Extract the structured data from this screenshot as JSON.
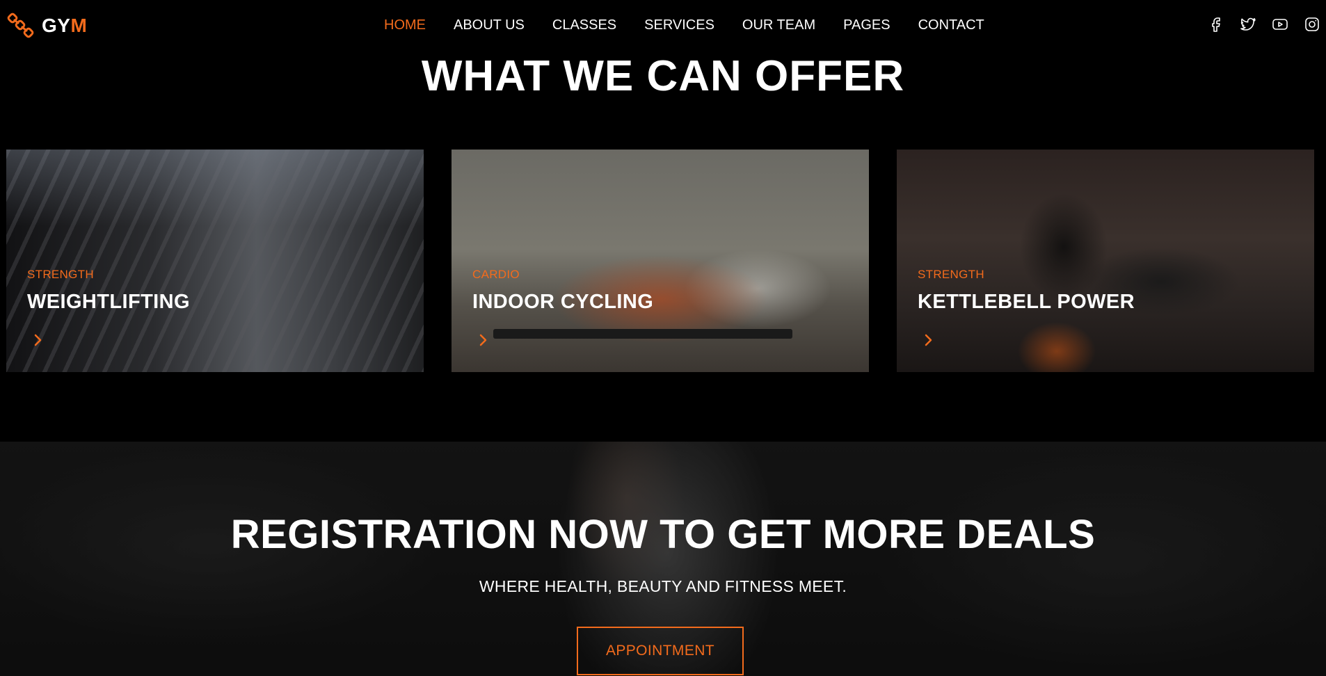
{
  "brand": {
    "logo_main": "GY",
    "logo_accent": "M"
  },
  "nav": {
    "items": [
      {
        "label": "HOME",
        "active": true
      },
      {
        "label": "ABOUT US"
      },
      {
        "label": "CLASSES"
      },
      {
        "label": "SERVICES"
      },
      {
        "label": "OUR TEAM"
      },
      {
        "label": "PAGES"
      },
      {
        "label": "CONTACT"
      }
    ]
  },
  "social": [
    "facebook-icon",
    "twitter-icon",
    "youtube-icon",
    "instagram-icon"
  ],
  "offer": {
    "title": "WHAT WE CAN OFFER",
    "cards": [
      {
        "category": "STRENGTH",
        "name": "WEIGHTLIFTING"
      },
      {
        "category": "CARDIO",
        "name": "INDOOR CYCLING"
      },
      {
        "category": "STRENGTH",
        "name": "KETTLEBELL POWER"
      }
    ]
  },
  "registration": {
    "title": "REGISTRATION NOW TO GET MORE DEALS",
    "subtitle": "WHERE HEALTH, BEAUTY AND FITNESS MEET.",
    "button": "APPOINTMENT"
  },
  "colors": {
    "accent": "#f36b1c",
    "background": "#000000",
    "text": "#ffffff"
  }
}
